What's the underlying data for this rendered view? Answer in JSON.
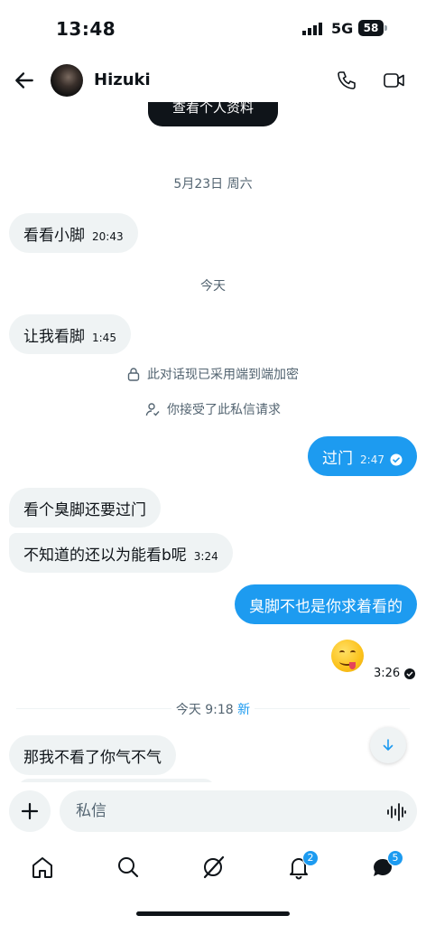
{
  "status_bar": {
    "time": "13:48",
    "network": "5G",
    "battery": "58"
  },
  "header": {
    "contact_name": "Hizuki",
    "profile_button": "查看个人资料"
  },
  "dates": {
    "first": "5月23日 周六",
    "today": "今天"
  },
  "messages": [
    {
      "text": "看看小脚",
      "time": "20:43"
    },
    {
      "text": "让我看脚",
      "time": "1:45"
    },
    {
      "text": "过门",
      "time": "2:47"
    },
    {
      "text": "看个臭脚还要过门",
      "time": ""
    },
    {
      "text": "不知道的还以为能看b呢",
      "time": "3:24"
    },
    {
      "text": "臭脚不也是你求着看的",
      "time": ""
    },
    {
      "text": "那我不看了你气不气",
      "time": ""
    }
  ],
  "system": {
    "encrypted": "此对话现已采用端到端加密",
    "accepted": "你接受了此私信请求"
  },
  "emoji_message": {
    "time": "3:26"
  },
  "new_divider": {
    "label": "今天 9:18",
    "new": "新"
  },
  "composer": {
    "placeholder": "私信"
  },
  "nav": {
    "notifications_badge": "2",
    "messages_badge": "5"
  },
  "colors": {
    "accent": "#1d9bf0",
    "bubble_in": "#eff3f4",
    "text": "#0f1419",
    "muted": "#536471"
  }
}
